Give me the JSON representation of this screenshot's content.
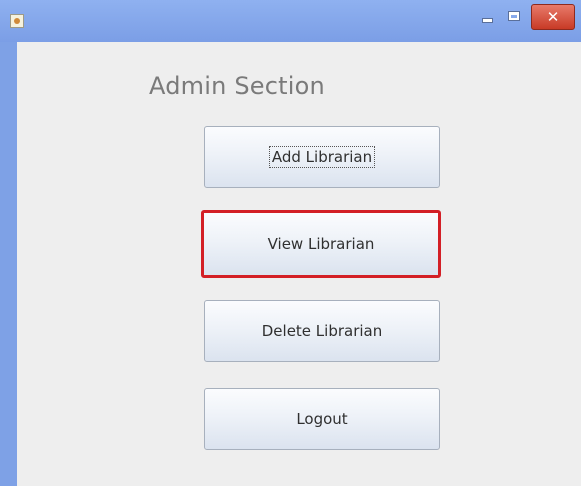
{
  "window": {
    "controls": {
      "minimize_icon": "minimize-icon",
      "maximize_icon": "maximize-icon",
      "close_icon": "close-icon",
      "close_glyph": "✕"
    }
  },
  "admin": {
    "heading": "Admin Section",
    "buttons": [
      {
        "label": "Add Librarian"
      },
      {
        "label": "View Librarian"
      },
      {
        "label": "Delete Librarian"
      },
      {
        "label": "Logout"
      }
    ]
  },
  "colors": {
    "titlebar": "#7b9ee6",
    "background": "#eeeeee",
    "highlight": "#d31f26",
    "close_button": "#c83a26"
  }
}
